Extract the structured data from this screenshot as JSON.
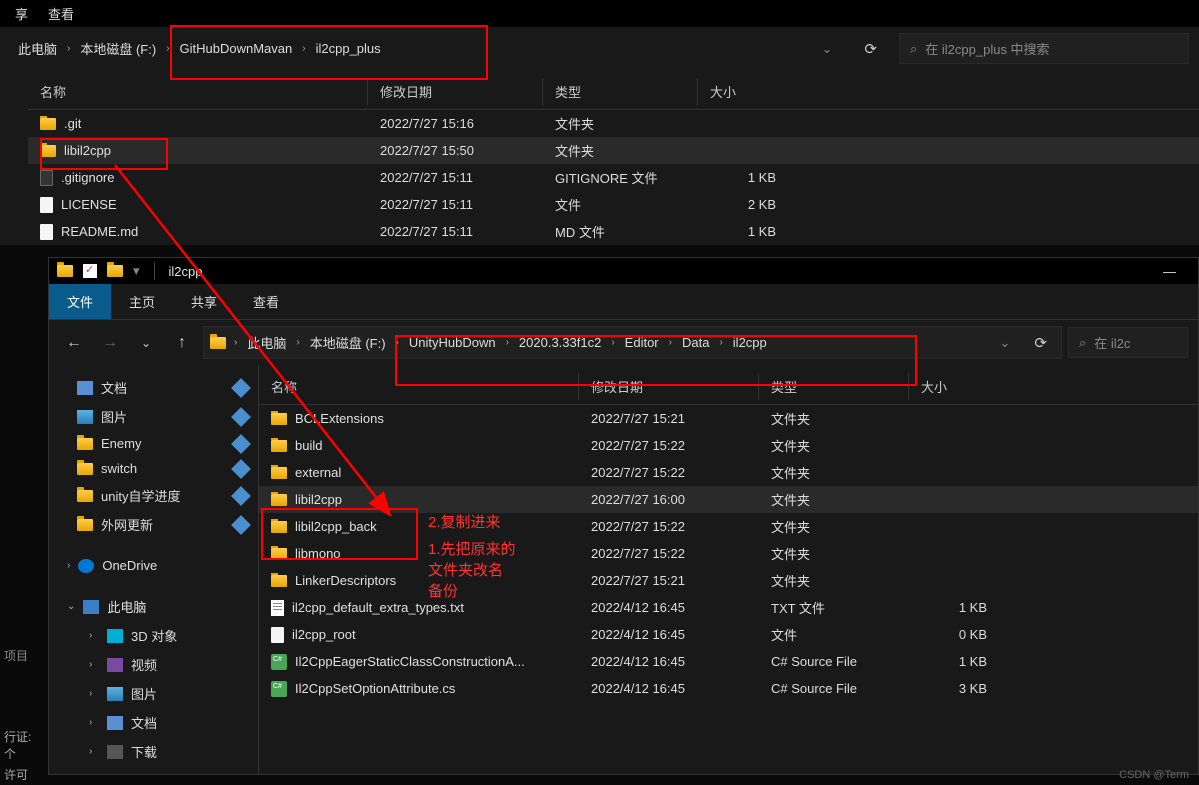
{
  "top_window": {
    "menu": {
      "share": "享",
      "view": "查看"
    },
    "breadcrumbs": [
      "此电脑",
      "本地磁盘 (F:)",
      "GitHubDownMavan",
      "il2cpp_plus"
    ],
    "search_placeholder": "在 il2cpp_plus 中搜索",
    "columns": {
      "name": "名称",
      "date": "修改日期",
      "type": "类型",
      "size": "大小"
    },
    "files": [
      {
        "icon": "folder",
        "name": ".git",
        "date": "2022/7/27 15:16",
        "type": "文件夹",
        "size": ""
      },
      {
        "icon": "folder",
        "name": "libil2cpp",
        "date": "2022/7/27 15:50",
        "type": "文件夹",
        "size": "",
        "sel": true
      },
      {
        "icon": "file-dark",
        "name": ".gitignore",
        "date": "2022/7/27 15:11",
        "type": "GITIGNORE 文件",
        "size": "1 KB"
      },
      {
        "icon": "file",
        "name": "LICENSE",
        "date": "2022/7/27 15:11",
        "type": "文件",
        "size": "2 KB"
      },
      {
        "icon": "file",
        "name": "README.md",
        "date": "2022/7/27 15:11",
        "type": "MD 文件",
        "size": "1 KB"
      }
    ]
  },
  "bottom_window": {
    "title": "il2cpp",
    "tabs": {
      "file": "文件",
      "home": "主页",
      "share": "共享",
      "view": "查看"
    },
    "breadcrumbs": [
      "此电脑",
      "本地磁盘 (F:)",
      "UnityHubDown",
      "2020.3.33f1c2",
      "Editor",
      "Data",
      "il2cpp"
    ],
    "search_placeholder": "在 il2c",
    "sidebar": [
      {
        "icon": "doc",
        "label": "文档"
      },
      {
        "icon": "pic",
        "label": "图片"
      },
      {
        "icon": "folder",
        "label": "Enemy"
      },
      {
        "icon": "folder",
        "label": "switch"
      },
      {
        "icon": "folder",
        "label": "unity自学进度"
      },
      {
        "icon": "folder",
        "label": "外网更新"
      }
    ],
    "sidebar_groups": [
      {
        "icon": "od",
        "label": "OneDrive"
      },
      {
        "icon": "pc",
        "label": "此电脑"
      }
    ],
    "sidebar_sub": [
      {
        "icon": "3d",
        "label": "3D 对象"
      },
      {
        "icon": "vid",
        "label": "视频"
      },
      {
        "icon": "pic",
        "label": "图片"
      },
      {
        "icon": "doc",
        "label": "文档"
      },
      {
        "icon": "dl",
        "label": "下载"
      }
    ],
    "columns": {
      "name": "名称",
      "date": "修改日期",
      "type": "类型",
      "size": "大小"
    },
    "files": [
      {
        "icon": "folder",
        "name": "BCLExtensions",
        "date": "2022/7/27 15:21",
        "type": "文件夹",
        "size": ""
      },
      {
        "icon": "folder",
        "name": "build",
        "date": "2022/7/27 15:22",
        "type": "文件夹",
        "size": ""
      },
      {
        "icon": "folder",
        "name": "external",
        "date": "2022/7/27 15:22",
        "type": "文件夹",
        "size": ""
      },
      {
        "icon": "folder",
        "name": "libil2cpp",
        "date": "2022/7/27 16:00",
        "type": "文件夹",
        "size": "",
        "sel": true
      },
      {
        "icon": "folder",
        "name": "libil2cpp_back",
        "date": "2022/7/27 15:22",
        "type": "文件夹",
        "size": ""
      },
      {
        "icon": "folder",
        "name": "libmono",
        "date": "2022/7/27 15:22",
        "type": "文件夹",
        "size": ""
      },
      {
        "icon": "folder",
        "name": "LinkerDescriptors",
        "date": "2022/7/27 15:21",
        "type": "文件夹",
        "size": ""
      },
      {
        "icon": "txt",
        "name": "il2cpp_default_extra_types.txt",
        "date": "2022/4/12 16:45",
        "type": "TXT 文件",
        "size": "1 KB"
      },
      {
        "icon": "file",
        "name": "il2cpp_root",
        "date": "2022/4/12 16:45",
        "type": "文件",
        "size": "0 KB"
      },
      {
        "icon": "cs",
        "name": "Il2CppEagerStaticClassConstructionA...",
        "date": "2022/4/12 16:45",
        "type": "C# Source File",
        "size": "1 KB"
      },
      {
        "icon": "cs",
        "name": "Il2CppSetOptionAttribute.cs",
        "date": "2022/4/12 16:45",
        "type": "C# Source File",
        "size": "3 KB"
      }
    ]
  },
  "annotations": {
    "note2": "2.复制进来",
    "note1_l1": "1.先把原来的",
    "note1_l2": "文件夹改名",
    "note1_l3": "备份"
  },
  "left_text": {
    "l1": "项目",
    "l2": "行证: 个",
    "l3": "许可"
  },
  "watermark": "CSDN @Term"
}
